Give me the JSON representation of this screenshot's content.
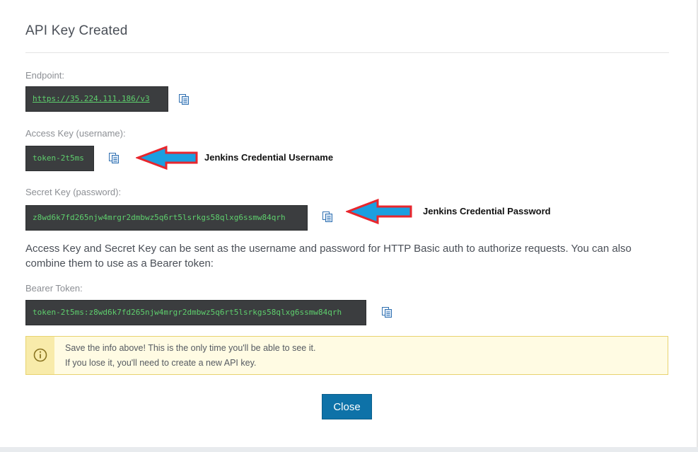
{
  "dialog": {
    "title": "API Key Created",
    "close_label": "Close"
  },
  "fields": {
    "endpoint": {
      "label": "Endpoint:",
      "value": "https://35.224.111.186/v3"
    },
    "access_key": {
      "label": "Access Key (username):",
      "value": "token-2t5ms"
    },
    "secret_key": {
      "label": "Secret Key (password):",
      "value": "z8wd6k7fd265njw4mrgr2dmbwz5q6rt5lsrkgs58qlxg6ssmw84qrh"
    },
    "bearer_token": {
      "label": "Bearer Token:",
      "value": "token-2t5ms:z8wd6k7fd265njw4mrgr2dmbwz5q6rt5lsrkgs58qlxg6ssmw84qrh"
    }
  },
  "description": "Access Key and Secret Key can be sent as the username and password for HTTP Basic auth to authorize requests. You can also combine them to use as a Bearer token:",
  "alert": {
    "line1": "Save the info above! This is the only time you'll be able to see it.",
    "line2": "If you lose it, you'll need to create a new API key.",
    "icon": "info-circle-icon"
  },
  "annotations": {
    "username_note": "Jenkins Credential Username",
    "password_note": "Jenkins Credential Password",
    "arrow_color": "#e8262d",
    "arrow_fill": "#1b9fe0"
  },
  "colors": {
    "primary_button": "#0e72a8",
    "code_background": "#3b3d3f",
    "code_text": "#5ecf6d",
    "alert_border": "#e8d36f"
  }
}
